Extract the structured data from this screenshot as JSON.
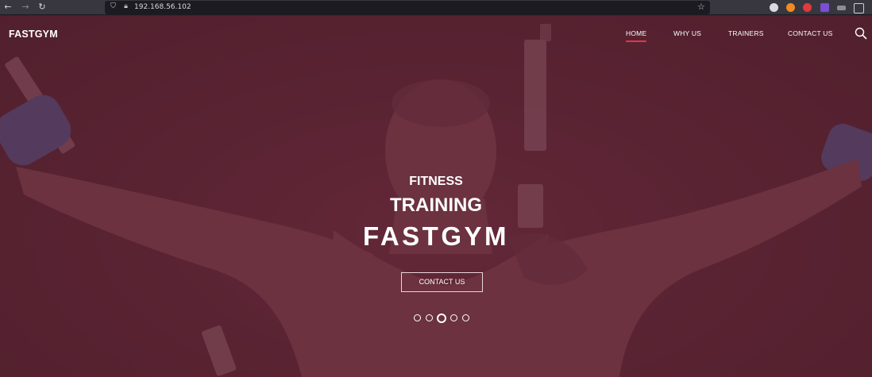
{
  "browser": {
    "url": "192.168.56.102",
    "back_icon": "back-arrow-icon",
    "forward_icon": "forward-arrow-icon",
    "reload_icon": "reload-icon",
    "shield_icon": "shield-icon",
    "lock_icon": "lock-icon",
    "bookmark_icon": "star-icon"
  },
  "site": {
    "logo": "FASTGYM",
    "menu": [
      {
        "label": "HOME",
        "active": true
      },
      {
        "label": "WHY US",
        "active": false
      },
      {
        "label": "TRAINERS",
        "active": false
      },
      {
        "label": "CONTACT US",
        "active": false
      }
    ],
    "search_icon": "search-icon",
    "accent": "#e8334e"
  },
  "hero": {
    "line1": "FITNESS",
    "line2": "TRAINING",
    "line3": "FASTGYM",
    "cta": "CONTACT US",
    "overlay_color": "#5a2433",
    "slides": 5,
    "active_slide": 3
  }
}
